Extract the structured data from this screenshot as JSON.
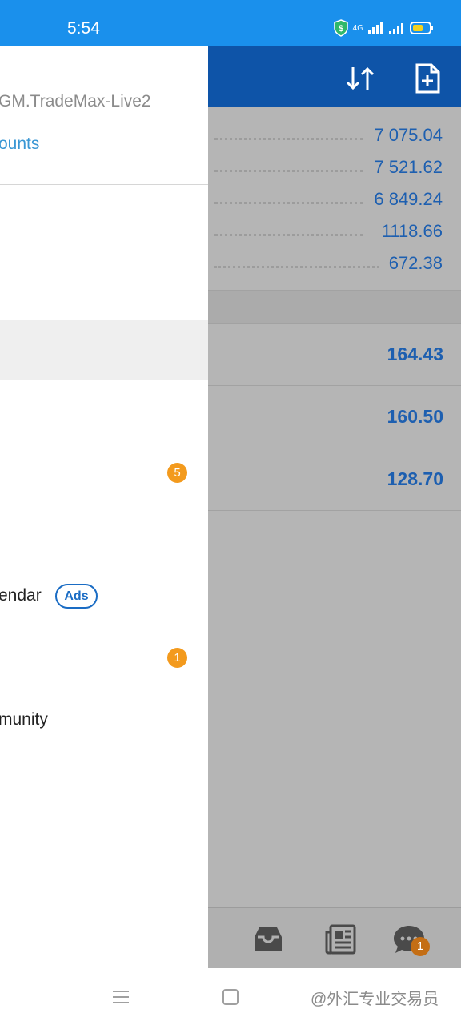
{
  "status_bar": {
    "time": "5:54",
    "network": "4G"
  },
  "app_toolbar": {
    "icons": [
      "sort-icon",
      "new-document-icon"
    ]
  },
  "summary": {
    "values": [
      "7 075.04",
      "7 521.62",
      "6 849.24",
      "1118.66",
      "672.38"
    ]
  },
  "trades": {
    "profits": [
      "164.43",
      "160.50",
      "128.70"
    ]
  },
  "bottom_nav": {
    "icons": [
      "mailbox-icon",
      "news-icon",
      "chat-icon"
    ],
    "chat_badge": "1"
  },
  "drawer": {
    "server": "GM.TradeMax-Live2",
    "accounts_link": "ounts",
    "badge_5": "5",
    "calendar_label": "endar",
    "ads_label": "Ads",
    "badge_1": "1",
    "community_label": "munity"
  },
  "system_nav": {
    "watermark": "@外汇专业交易员"
  },
  "colors": {
    "status_bar": "#1a90ec",
    "toolbar": "#0e54a8",
    "accent_link": "#3a97d4",
    "value_blue": "#1d5fb0",
    "badge_orange": "#f39a1d"
  }
}
